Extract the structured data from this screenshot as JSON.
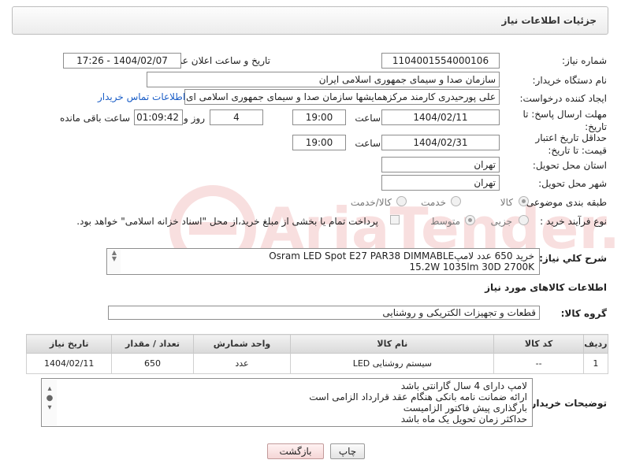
{
  "panel": {
    "title": "جزئیات اطلاعات نیاز"
  },
  "fields": {
    "need_number_label": "شماره نیاز:",
    "need_number": "1104001554000106",
    "announce_label": "تاریخ و ساعت اعلان عمومی:",
    "announce_value": "1404/02/07 - 17:26",
    "buyer_org_label": "نام دستگاه خریدار:",
    "buyer_org": "سازمان صدا و سیمای جمهوری اسلامی ایران",
    "creator_label": "ایجاد کننده درخواست:",
    "creator": "علی پورحیدری کارمند مرکزهمایشها سازمان صدا و سیمای جمهوری اسلامی ای",
    "contact_link": "اطلاعات تماس خریدار",
    "reply_deadline_label": "مهلت ارسال پاسخ: تا تاریخ:",
    "reply_date": "1404/02/11",
    "time_label": "ساعت",
    "reply_time": "19:00",
    "days_value": "4",
    "days_label": "روز و",
    "remaining_time": "01:09:42",
    "remaining_label": "ساعت باقی مانده",
    "price_deadline_label": "حداقل تاریخ اعتبار قیمت: تا تاریخ:",
    "price_date": "1404/02/31",
    "price_time": "19:00",
    "province_label": "استان محل تحویل:",
    "province": "تهران",
    "city_label": "شهر محل تحویل:",
    "city": "تهران",
    "category_label": "طبقه بندی موضوعی:",
    "category_options": [
      "کالا",
      "خدمت",
      "کالا/خدمت"
    ],
    "process_label": "نوع فرآیند خرید :",
    "process_options": [
      "جزیی",
      "متوسط"
    ],
    "payment_note": "پرداخت تمام یا بخشی از مبلغ خرید،از محل \"اسناد خزانه اسلامی\" خواهد بود."
  },
  "summary": {
    "label": "شرح کلي نياز:",
    "line1": "خرید   650    عدد لامپOsram LED Spot E27 PAR38 DIMMABLE",
    "line2": "15.2W 1035lm 30D 2700K"
  },
  "goods_info": {
    "heading": "اطلاعات کالاهای مورد نیاز",
    "group_label": "گروه کالا:",
    "group_value": "قطعات و تجهیزات الکتریکی و روشنایی"
  },
  "table": {
    "headers": [
      "ردیف",
      "کد کالا",
      "نام کالا",
      "واحد شمارش",
      "تعداد / مقدار",
      "تاریخ نیاز"
    ],
    "rows": [
      [
        "1",
        "--",
        "سیستم روشنایی LED",
        "عدد",
        "650",
        "1404/02/11"
      ]
    ]
  },
  "notes": {
    "label": "توضیحات خریدار:",
    "lines": [
      "لامپ دارای 4 سال گارانتی باشد",
      "ارائه ضمانت نامه بانکی هنگام عقد قرارداد الزامی است",
      "بارگذاری پیش فاکتور الزامیست",
      "حداکثر زمان تحویل یک ماه باشد"
    ]
  },
  "buttons": {
    "print": "چاپ",
    "back": "بازگشت"
  },
  "colors": {
    "link": "#1b5ec7",
    "back_button": "#f5d6d6"
  }
}
